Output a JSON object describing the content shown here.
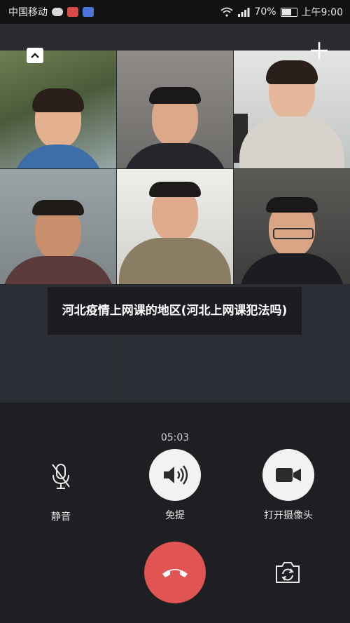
{
  "status_bar": {
    "carrier": "中国移动",
    "battery_percent": "70%",
    "time": "上午9:00",
    "battery_level": 0.7
  },
  "overlay": {
    "caption": "河北疫情上网课的地区(河北上网课犯法吗)"
  },
  "call": {
    "duration": "05:03",
    "controls": {
      "mute_label": "静音",
      "speaker_label": "免提",
      "camera_label": "打开摄像头"
    }
  },
  "icons": {
    "collapse": "chevron-up-icon",
    "add": "plus-icon",
    "mute": "microphone-off-icon",
    "speaker": "speaker-icon",
    "camera": "video-camera-icon",
    "hangup": "phone-hangup-icon",
    "flip": "camera-flip-icon"
  },
  "colors": {
    "hangup": "#e05454",
    "panel": "#1e1f22",
    "caption_bg": "#19191e"
  }
}
